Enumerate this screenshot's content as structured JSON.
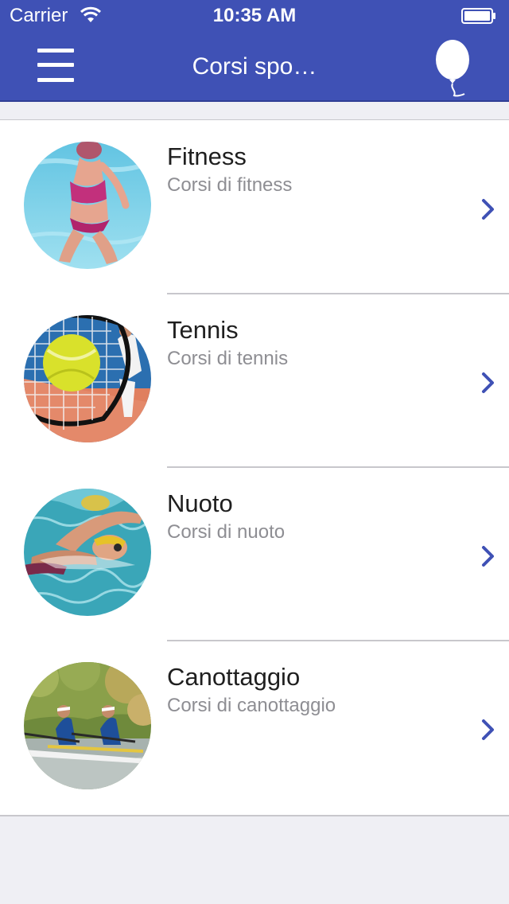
{
  "status_bar": {
    "carrier": "Carrier",
    "time": "10:35 AM"
  },
  "nav": {
    "title": "Corsi spo…",
    "left_icon": "menu-icon",
    "right_icon": "balloon-icon"
  },
  "colors": {
    "header": "#3f51b5",
    "accent": "#3f51b5",
    "subtitle": "#8e8e93",
    "background": "#efeff4"
  },
  "courses": [
    {
      "title": "Fitness",
      "subtitle": "Corsi di fitness",
      "image": "fitness-photo"
    },
    {
      "title": "Tennis",
      "subtitle": "Corsi di tennis",
      "image": "tennis-photo"
    },
    {
      "title": "Nuoto",
      "subtitle": "Corsi di nuoto",
      "image": "swimming-photo"
    },
    {
      "title": "Canottaggio",
      "subtitle": "Corsi di canottaggio",
      "image": "rowing-photo"
    }
  ]
}
